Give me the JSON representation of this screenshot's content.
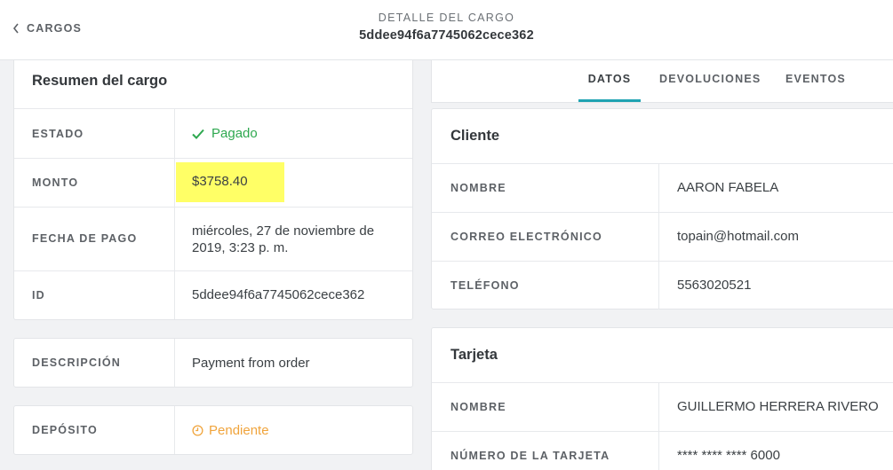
{
  "header": {
    "back_label": "CARGOS",
    "title": "DETALLE DEL CARGO",
    "charge_id": "5ddee94f6a7745062cece362"
  },
  "summary": {
    "title": "Resumen del cargo",
    "status_label": "ESTADO",
    "status_value": "Pagado",
    "amount_label": "MONTO",
    "amount_value": "$3758.40",
    "payment_date_label": "FECHA DE PAGO",
    "payment_date_line1": "miércoles, 27 de noviembre de",
    "payment_date_line2": "2019, 3:23 p. m.",
    "id_label": "ID",
    "id_value": "5ddee94f6a7745062cece362"
  },
  "description": {
    "label": "DESCRIPCIÓN",
    "value": "Payment from order"
  },
  "deposit": {
    "label": "DEPÓSITO",
    "value": "Pendiente"
  },
  "tabs": [
    {
      "label": "DATOS",
      "active": true
    },
    {
      "label": "DEVOLUCIONES",
      "active": false
    },
    {
      "label": "EVENTOS",
      "active": false
    }
  ],
  "client": {
    "title": "Cliente",
    "name_label": "NOMBRE",
    "name_value": "AARON FABELA",
    "email_label": "CORREO ELECTRÓNICO",
    "email_value": "topain@hotmail.com",
    "phone_label": "TELÉFONO",
    "phone_value": "5563020521"
  },
  "card": {
    "title": "Tarjeta",
    "name_label": "NOMBRE",
    "name_value": "GUILLERMO HERRERA RIVERO",
    "number_label": "NÚMERO DE LA TARJETA",
    "number_value": "**** **** **** 6000"
  },
  "colors": {
    "paid": "#2ea84f",
    "pending": "#f0a43c",
    "highlight": "#ffff66",
    "tab_active_underline": "#1fa3b2"
  }
}
